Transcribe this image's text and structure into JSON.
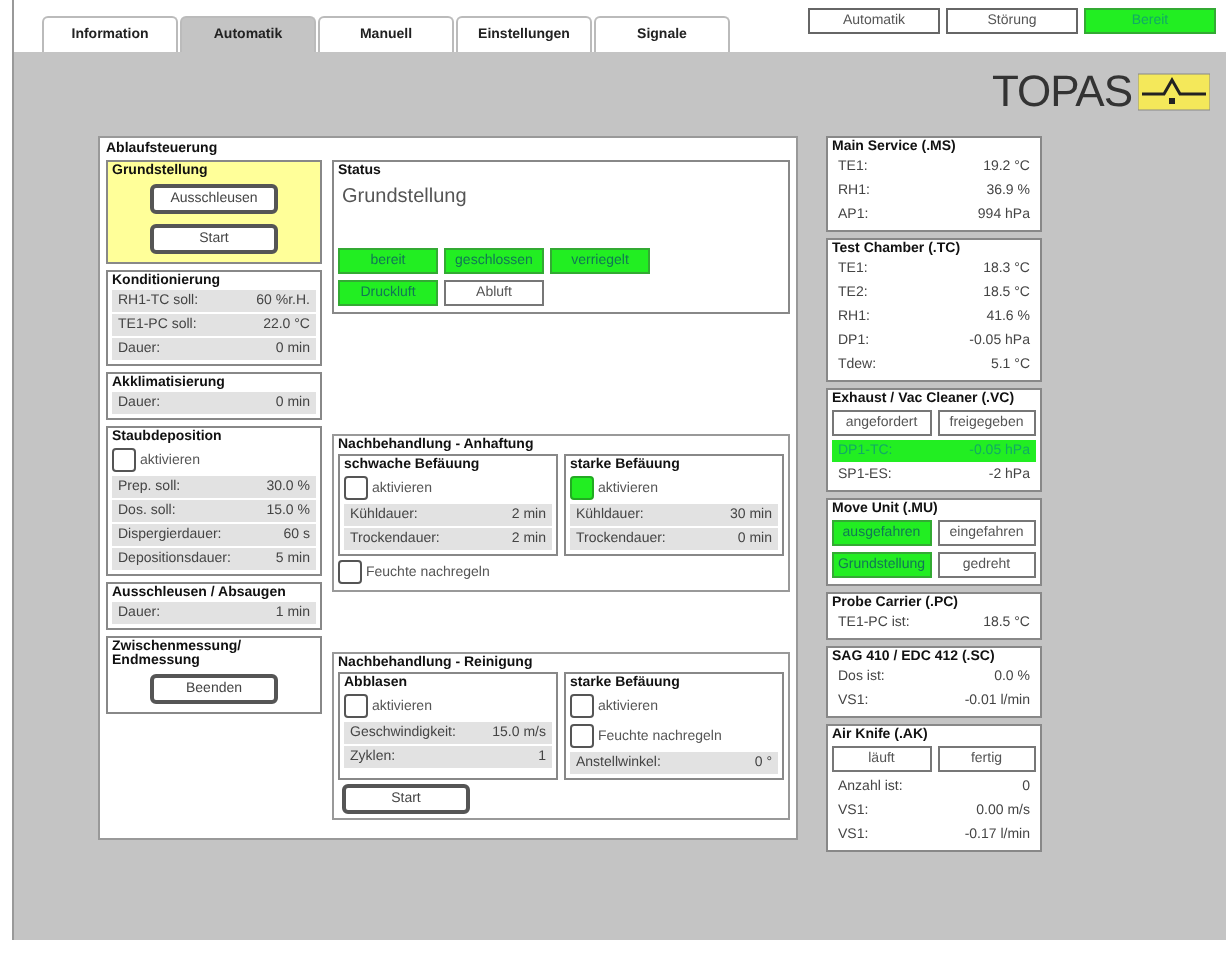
{
  "tabs": [
    {
      "label": "Information",
      "selected": false
    },
    {
      "label": "Automatik",
      "selected": true
    },
    {
      "label": "Manuell",
      "selected": false
    },
    {
      "label": "Einstellungen",
      "selected": false
    },
    {
      "label": "Signale",
      "selected": false
    }
  ],
  "indicators": [
    {
      "label": "Automatik",
      "on": false
    },
    {
      "label": "Störung",
      "on": false
    },
    {
      "label": "Bereit",
      "on": true
    }
  ],
  "logo": {
    "text": "TOPAS"
  },
  "main": {
    "title": "Ablaufsteuerung",
    "left": [
      {
        "title": "Grundstellung",
        "active": true,
        "items": [
          {
            "kind": "button",
            "label": "Ausschleusen"
          },
          {
            "kind": "button",
            "label": "Start"
          }
        ]
      },
      {
        "title": "Konditionierung",
        "active": false,
        "items": [
          {
            "kind": "row",
            "label": "RH1-TC soll:",
            "value": "60 %r.H."
          },
          {
            "kind": "row",
            "label": "TE1-PC soll:",
            "value": "22.0 °C"
          },
          {
            "kind": "row",
            "label": "Dauer:",
            "value": "0 min"
          }
        ]
      },
      {
        "title": "Akklimatisierung",
        "active": false,
        "items": [
          {
            "kind": "row",
            "label": "Dauer:",
            "value": "0 min"
          }
        ]
      },
      {
        "title": "Staubdeposition",
        "active": false,
        "items": [
          {
            "kind": "check",
            "label": "aktivieren",
            "checked": false
          },
          {
            "kind": "row",
            "label": "Prep. soll:",
            "value": "30.0 %"
          },
          {
            "kind": "row",
            "label": "Dos. soll:",
            "value": "15.0 %"
          },
          {
            "kind": "row",
            "label": "Dispergierdauer:",
            "value": "60 s"
          },
          {
            "kind": "row",
            "label": "Depositionsdauer:",
            "value": "5 min"
          }
        ]
      },
      {
        "title": "Ausschleusen / Absaugen",
        "active": false,
        "items": [
          {
            "kind": "row",
            "label": "Dauer:",
            "value": "1 min"
          }
        ]
      },
      {
        "title": "Zwischenmessung/ Endmessung",
        "active": false,
        "items": [
          {
            "kind": "button",
            "label": "Beenden"
          }
        ]
      }
    ],
    "status": {
      "title": "Status",
      "items": [
        {
          "kind": "text",
          "text": "Grundstellung"
        },
        {
          "kind": "buttons",
          "buttons": [
            {
              "label": "bereit",
              "on": true
            },
            {
              "label": "geschlossen",
              "on": true
            },
            {
              "label": "verriegelt",
              "on": true
            }
          ]
        },
        {
          "kind": "buttons",
          "buttons": [
            {
              "label": "Druckluft",
              "on": true
            },
            {
              "label": "Abluft",
              "on": false
            }
          ]
        }
      ]
    },
    "sections": [
      {
        "title": "Nachbehandlung - Anhaftung",
        "columns": [
          {
            "title": "schwache Befäuung",
            "items": [
              {
                "kind": "check",
                "label": "aktivieren",
                "checked": false
              },
              {
                "kind": "row",
                "label": "Kühldauer:",
                "value": "2 min"
              },
              {
                "kind": "row",
                "label": "Trockendauer:",
                "value": "2 min"
              }
            ]
          },
          {
            "title": "starke Befäuung",
            "items": [
              {
                "kind": "check",
                "label": "aktivieren",
                "checked": true
              },
              {
                "kind": "row",
                "label": "Kühldauer:",
                "value": "30 min"
              },
              {
                "kind": "row",
                "label": "Trockendauer:",
                "value": "0 min"
              }
            ]
          }
        ],
        "items": [
          {
            "kind": "check",
            "label": "Feuchte nachregeln",
            "checked": false
          }
        ]
      },
      {
        "title": "Nachbehandlung - Reinigung",
        "columns": [
          {
            "title": "Abblasen",
            "items": [
              {
                "kind": "check",
                "label": "aktivieren",
                "checked": false
              },
              {
                "kind": "row",
                "label": "Geschwindigkeit:",
                "value": "15.0 m/s"
              },
              {
                "kind": "row",
                "label": "Zyklen:",
                "value": "1"
              }
            ]
          },
          {
            "title": "starke Befäuung",
            "items": [
              {
                "kind": "check",
                "label": "aktivieren",
                "checked": false
              },
              {
                "kind": "check",
                "label": "Feuchte nachregeln",
                "checked": false
              },
              {
                "kind": "row",
                "label": "Anstellwinkel:",
                "value": "0 °"
              }
            ]
          }
        ],
        "items": [
          {
            "kind": "button",
            "label": "Start"
          }
        ]
      }
    ]
  },
  "right": [
    {
      "title": "Main Service (.MS)",
      "items": [
        {
          "kind": "row",
          "label": "TE1:",
          "value": "19.2 °C"
        },
        {
          "kind": "row",
          "label": "RH1:",
          "value": "36.9 %"
        },
        {
          "kind": "row",
          "label": "AP1:",
          "value": "994 hPa"
        }
      ]
    },
    {
      "title": "Test Chamber (.TC)",
      "items": [
        {
          "kind": "row",
          "label": "TE1:",
          "value": "18.3 °C"
        },
        {
          "kind": "row",
          "label": "TE2:",
          "value": "18.5 °C"
        },
        {
          "kind": "row",
          "label": "RH1:",
          "value": "41.6 %"
        },
        {
          "kind": "row",
          "label": "DP1:",
          "value": "-0.05 hPa"
        },
        {
          "kind": "row",
          "label": "Tdew:",
          "value": "5.1 °C"
        }
      ]
    },
    {
      "title": "Exhaust / Vac Cleaner (.VC)",
      "items": [
        {
          "kind": "buttons",
          "buttons": [
            {
              "label": "angefordert",
              "on": false
            },
            {
              "label": "freigegeben",
              "on": false
            }
          ]
        },
        {
          "kind": "row",
          "label": "DP1-TC:",
          "value": "-0.05 hPa",
          "highlighted": true
        },
        {
          "kind": "row",
          "label": "SP1-ES:",
          "value": "-2 hPa",
          "highlighted": false
        }
      ]
    },
    {
      "title": "Move Unit (.MU)",
      "items": [
        {
          "kind": "buttons",
          "buttons": [
            {
              "label": "ausgefahren",
              "on": true
            },
            {
              "label": "eingefahren",
              "on": false
            }
          ]
        },
        {
          "kind": "buttons",
          "buttons": [
            {
              "label": "Grundstellung",
              "on": true
            },
            {
              "label": "gedreht",
              "on": false
            }
          ]
        }
      ]
    },
    {
      "title": "Probe Carrier (.PC)",
      "items": [
        {
          "kind": "row",
          "label": "TE1-PC ist:",
          "value": "18.5 °C"
        }
      ]
    },
    {
      "title": "SAG 410 / EDC 412 (.SC)",
      "items": [
        {
          "kind": "row",
          "label": "Dos ist:",
          "value": "0.0 %"
        },
        {
          "kind": "row",
          "label": "VS1:",
          "value": "-0.01 l/min"
        }
      ]
    },
    {
      "title": "Air Knife (.AK)",
      "items": [
        {
          "kind": "buttons",
          "buttons": [
            {
              "label": "läuft",
              "on": false
            },
            {
              "label": "fertig",
              "on": false
            }
          ]
        },
        {
          "kind": "row",
          "label": "Anzahl ist:",
          "value": "0"
        },
        {
          "kind": "row",
          "label": "VS1:",
          "value": "0.00 m/s"
        },
        {
          "kind": "row",
          "label": "VS1:",
          "value": "-0.17 l/min"
        }
      ]
    }
  ]
}
